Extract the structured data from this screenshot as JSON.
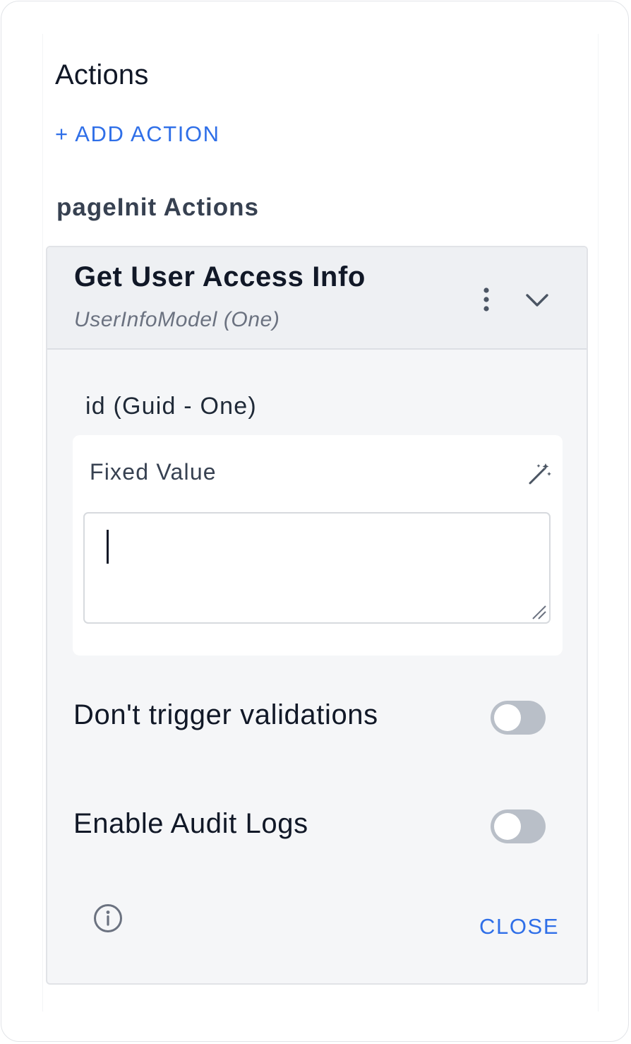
{
  "panel": {
    "title": "Actions",
    "add_action_label": "+ ADD ACTION",
    "section_title": "pageInit Actions"
  },
  "action_card": {
    "title": "Get User Access Info",
    "subtitle": "UserInfoModel (One)",
    "param": {
      "label": "id (Guid - One)",
      "value_mode_label": "Fixed Value",
      "value": ""
    },
    "toggles": [
      {
        "label": "Don't trigger validations",
        "on": false
      },
      {
        "label": "Enable Audit Logs",
        "on": false
      }
    ],
    "close_label": "CLOSE"
  },
  "icons": {
    "more": "kebab-menu-icon",
    "expand": "chevron-down-icon",
    "magic": "magic-wand-icon",
    "info": "info-circle-icon"
  },
  "colors": {
    "accent": "#2f6fe8",
    "toggle_off": "#b9bfc8",
    "card_bg": "#f5f6f8",
    "header_bg": "#eef0f3"
  }
}
